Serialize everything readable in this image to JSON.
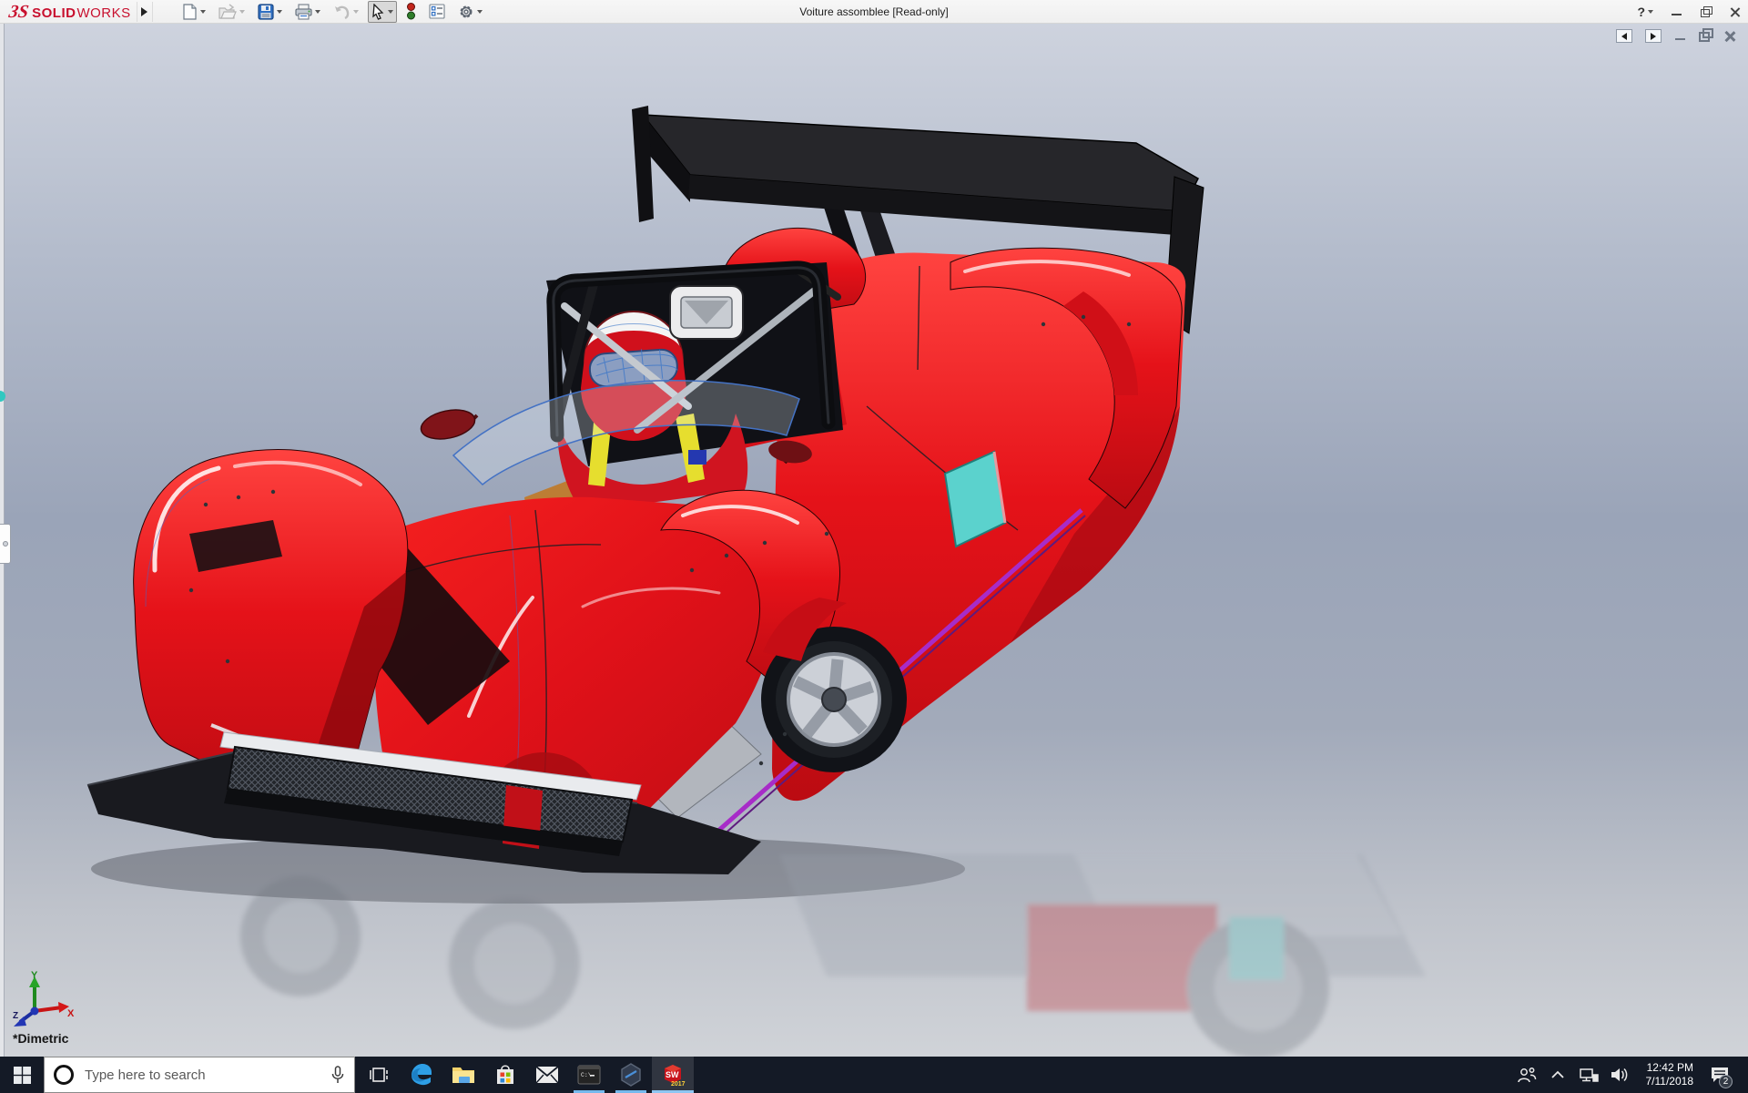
{
  "window": {
    "brand": {
      "mark": "3S",
      "bold": "SOLID",
      "light": "WORKS"
    },
    "title": "Voiture assomblee [Read-only]",
    "controls": {
      "help": "?"
    }
  },
  "toolbar": {
    "items": [
      {
        "name": "new-document",
        "dropdown": true
      },
      {
        "name": "open",
        "dropdown": true,
        "disabled": true
      },
      {
        "name": "save",
        "dropdown": true
      },
      {
        "name": "print",
        "dropdown": true
      },
      {
        "name": "undo",
        "dropdown": true,
        "disabled": true
      },
      {
        "name": "select",
        "dropdown": true,
        "active": true
      },
      {
        "name": "rebuild"
      },
      {
        "name": "file-properties"
      },
      {
        "name": "options",
        "dropdown": true
      }
    ]
  },
  "document_window": {
    "controls": [
      "previous-pane",
      "next-pane",
      "minimize",
      "restore",
      "close"
    ]
  },
  "viewport": {
    "view_label": "*Dimetric",
    "triad": {
      "x": "X",
      "y": "Y",
      "z": "Z"
    },
    "model": "red prototype race car assembly with driver figure and black rear wing"
  },
  "taskbar": {
    "search_placeholder": "Type here to search",
    "icons": [
      "start",
      "task-view",
      "edge",
      "file-explorer",
      "store",
      "mail",
      "command-prompt",
      "hexagon-app",
      "solidworks-2017"
    ],
    "running_apps": [
      "command-prompt",
      "hexagon-app",
      "solidworks-2017"
    ],
    "tray": {
      "time": "12:42 PM",
      "date": "7/11/2018",
      "notification_count": "2",
      "icons": [
        "people",
        "hidden-icons-chevron",
        "network",
        "volume",
        "action-center"
      ]
    }
  },
  "colors": {
    "brand_red": "#c8102e",
    "car_red": "#e01119",
    "wing_black": "#1c1c20",
    "accent_teal": "#5bd2cd",
    "accent_magenta": "#a72cc8",
    "taskbar_bg": "#141a26",
    "running_indicator": "#76b9ed",
    "background_top": "#ced3de",
    "background_mid": "#97a1b5"
  }
}
